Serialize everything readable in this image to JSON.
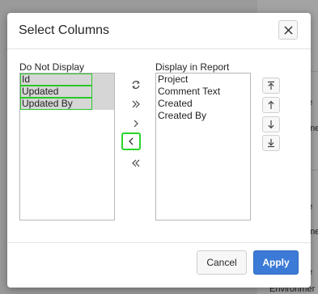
{
  "background": {
    "link_text": "ct",
    "fragments": [
      "e",
      "nmer",
      "e",
      "nmer",
      "e",
      "Environmer"
    ]
  },
  "dialog": {
    "title": "Select Columns",
    "close_icon": "close-icon",
    "left_list": {
      "label": "Do Not Display",
      "items": [
        "Id",
        "Updated",
        "Updated By"
      ]
    },
    "right_list": {
      "label": "Display in Report",
      "items": [
        "Project",
        "Comment Text",
        "Created",
        "Created By"
      ]
    },
    "move_buttons": [
      "reset-icon",
      "move-all-right-icon",
      "move-right-icon",
      "move-left-icon",
      "move-all-left-icon"
    ],
    "order_buttons": [
      "move-top-icon",
      "move-up-icon",
      "move-down-icon",
      "move-bottom-icon"
    ],
    "cancel_label": "Cancel",
    "apply_label": "Apply"
  },
  "colors": {
    "accent": "#3b7ad6",
    "highlight": "#2ad42a"
  }
}
